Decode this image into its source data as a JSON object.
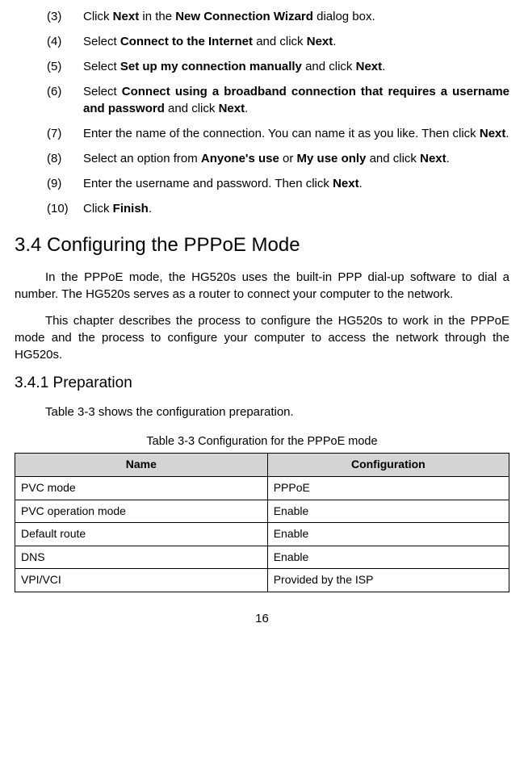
{
  "steps": [
    {
      "num": "(3)",
      "html": "Click <strong>Next</strong> in the <strong>New Connection Wizard</strong> dialog box."
    },
    {
      "num": "(4)",
      "html": "Select <strong>Connect to the Internet</strong> and click <strong>Next</strong>."
    },
    {
      "num": "(5)",
      "html": "Select <strong>Set up my connection manually</strong> and click <strong>Next</strong>."
    },
    {
      "num": "(6)",
      "html": "Select <strong>Connect using a broadband connection that requires a username and password</strong> and click <strong>Next</strong>.",
      "justify_first": true
    },
    {
      "num": "(7)",
      "html": "Enter the name of the connection. You can name it as you like. Then click <strong>Next</strong>."
    },
    {
      "num": "(8)",
      "html": "Select an option from <strong>Anyone's use</strong> or <strong>My use only</strong> and click <strong>Next</strong>."
    },
    {
      "num": "(9)",
      "html": "Enter the username and password. Then click <strong>Next</strong>."
    },
    {
      "num": "(10)",
      "html": "Click <strong>Finish</strong>."
    }
  ],
  "section_heading": "3.4  Configuring the PPPoE Mode",
  "para1": "In the PPPoE mode, the HG520s uses the built-in PPP dial-up software to dial a number. The HG520s serves as a router to connect your computer to the network.",
  "para2": "This chapter describes the process to configure the HG520s to work in the PPPoE mode and the process to configure your computer to access the network through the HG520s.",
  "subsection_heading": "3.4.1  Preparation",
  "para3": "Table 3-3 shows the configuration preparation.",
  "table_caption": "Table 3-3 Configuration for the PPPoE mode",
  "table": {
    "headers": [
      "Name",
      "Configuration"
    ],
    "rows": [
      [
        "PVC mode",
        "PPPoE"
      ],
      [
        "PVC operation mode",
        "Enable"
      ],
      [
        "Default route",
        "Enable"
      ],
      [
        "DNS",
        "Enable"
      ],
      [
        "VPI/VCI",
        "Provided by the ISP"
      ]
    ]
  },
  "page_number": "16"
}
